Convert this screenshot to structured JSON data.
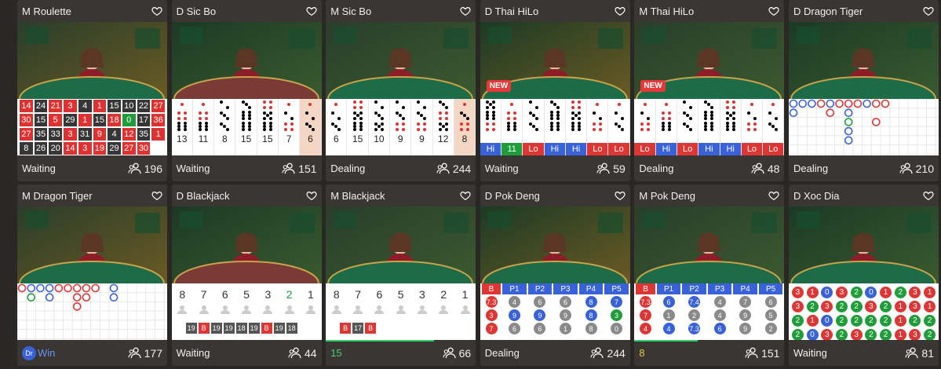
{
  "colors": {
    "accent_red": "#de3535",
    "accent_blue": "#3962d8",
    "accent_green": "#1f9d3a",
    "card_bg": "#3a3633"
  },
  "new_badge_label": "NEW",
  "cards": [
    {
      "title": "M Roulette",
      "status": "Waiting",
      "players": "196",
      "type": "roulette",
      "roulette": [
        [
          "14",
          "r"
        ],
        [
          "24",
          "k"
        ],
        [
          "21",
          "r"
        ],
        [
          "3",
          "r"
        ],
        [
          "4",
          "k"
        ],
        [
          "1",
          "r"
        ],
        [
          "15",
          "k"
        ],
        [
          "10",
          "k"
        ],
        [
          "22",
          "k"
        ],
        [
          "27",
          "r"
        ],
        [
          "30",
          "r"
        ],
        [
          "15",
          "k"
        ],
        [
          "5",
          "r"
        ],
        [
          "29",
          "k"
        ],
        [
          "1",
          "r"
        ],
        [
          "15",
          "k"
        ],
        [
          "18",
          "r"
        ],
        [
          "0",
          "g"
        ],
        [
          "17",
          "k"
        ],
        [
          "36",
          "r"
        ],
        [
          "27",
          "r"
        ],
        [
          "35",
          "k"
        ],
        [
          "33",
          "k"
        ],
        [
          "3",
          "r"
        ],
        [
          "31",
          "k"
        ],
        [
          "9",
          "r"
        ],
        [
          "4",
          "k"
        ],
        [
          "12",
          "r"
        ],
        [
          "35",
          "k"
        ],
        [
          "1",
          "r"
        ],
        [
          "8",
          "k"
        ],
        [
          "26",
          "k"
        ],
        [
          "20",
          "k"
        ],
        [
          "14",
          "r"
        ],
        [
          "3",
          "r"
        ],
        [
          "19",
          "r"
        ],
        [
          "29",
          "k"
        ],
        [
          "27",
          "r"
        ],
        [
          "30",
          "r"
        ]
      ]
    },
    {
      "title": "D Sic Bo",
      "status": "Waiting",
      "players": "151",
      "type": "sicbo",
      "dice": [
        {
          "faces": [
            1,
            4,
            6
          ],
          "sum": "13"
        },
        {
          "faces": [
            1,
            4,
            6
          ],
          "sum": "11"
        },
        {
          "faces": [
            2,
            3,
            3
          ],
          "sum": "8"
        },
        {
          "faces": [
            3,
            6,
            6
          ],
          "sum": "15"
        },
        {
          "faces": [
            4,
            5,
            6
          ],
          "sum": "15"
        },
        {
          "faces": [
            1,
            2,
            4
          ],
          "sum": "7"
        },
        {
          "faces": [
            1,
            2,
            3
          ],
          "sum": "6",
          "hl": true
        }
      ]
    },
    {
      "title": "M Sic Bo",
      "status": "Dealing",
      "players": "244",
      "type": "sicbo",
      "dice": [
        {
          "faces": [
            1,
            2,
            3
          ],
          "sum": "6"
        },
        {
          "faces": [
            4,
            5,
            6
          ],
          "sum": "15"
        },
        {
          "faces": [
            2,
            3,
            5
          ],
          "sum": "10"
        },
        {
          "faces": [
            2,
            3,
            4
          ],
          "sum": "9"
        },
        {
          "faces": [
            2,
            3,
            4
          ],
          "sum": "9"
        },
        {
          "faces": [
            3,
            4,
            5
          ],
          "sum": "12"
        },
        {
          "faces": [
            1,
            3,
            4
          ],
          "sum": "8",
          "hl": true
        }
      ]
    },
    {
      "title": "D Thai HiLo",
      "status": "Waiting",
      "players": "59",
      "type": "hilo",
      "new": true,
      "hilo": [
        {
          "faces": [
            5,
            6,
            4
          ],
          "tag": "Hi"
        },
        {
          "faces": [
            1,
            4,
            6
          ],
          "tag": "11"
        },
        {
          "faces": [
            2,
            3,
            3
          ],
          "tag": "Lo"
        },
        {
          "faces": [
            3,
            6,
            6
          ],
          "tag": "Hi"
        },
        {
          "faces": [
            4,
            5,
            6
          ],
          "tag": "Hi"
        },
        {
          "faces": [
            1,
            2,
            4
          ],
          "tag": "Lo"
        },
        {
          "faces": [
            1,
            2,
            3
          ],
          "tag": "Lo"
        }
      ]
    },
    {
      "title": "M Thai HiLo",
      "status": "Dealing",
      "players": "48",
      "type": "hilo",
      "new": true,
      "hilo": [
        {
          "faces": [
            1,
            2,
            4
          ],
          "tag": "Lo"
        },
        {
          "faces": [
            1,
            4,
            6
          ],
          "tag": "Hi"
        },
        {
          "faces": [
            2,
            3,
            3
          ],
          "tag": "Lo"
        },
        {
          "faces": [
            3,
            6,
            6
          ],
          "tag": "Hi"
        },
        {
          "faces": [
            4,
            5,
            6
          ],
          "tag": "Hi"
        },
        {
          "faces": [
            1,
            2,
            4
          ],
          "tag": "Lo"
        },
        {
          "faces": [
            1,
            2,
            3
          ],
          "tag": "Lo"
        }
      ]
    },
    {
      "title": "D Dragon Tiger",
      "status": "Dealing",
      "players": "210",
      "type": "dt1"
    },
    {
      "title": "M Dragon Tiger",
      "status": "Win",
      "status_badge": "Dr",
      "players": "177",
      "type": "dt2"
    },
    {
      "title": "D Blackjack",
      "status": "Waiting",
      "players": "44",
      "type": "bj",
      "seats": [
        "8",
        "7",
        "6",
        "5",
        "3",
        "2",
        "1"
      ],
      "history": [
        "19",
        "B",
        "19",
        "19",
        "18",
        "19",
        "B",
        "19",
        "18"
      ]
    },
    {
      "title": "M Blackjack",
      "status": "15",
      "players": "66",
      "type": "bj",
      "seats": [
        "8",
        "7",
        "6",
        "5",
        "3",
        "2",
        "1"
      ],
      "history": [
        "B",
        "17",
        "B"
      ],
      "progress": 0.72
    },
    {
      "title": "D Pok Deng",
      "status": "Dealing",
      "players": "244",
      "type": "pd",
      "pd_headers": [
        "B",
        "P1",
        "P2",
        "P3",
        "P4",
        "P5"
      ],
      "pd_cols": [
        [
          [
            "7.3",
            "red"
          ],
          [
            "3",
            "red"
          ],
          [
            "7",
            "red"
          ]
        ],
        [
          [
            "4",
            "gray"
          ],
          [
            "9",
            "blue"
          ],
          [
            "6",
            "gray"
          ]
        ],
        [
          [
            "6",
            "gray"
          ],
          [
            "9",
            "blue"
          ],
          [
            "6",
            "gray"
          ]
        ],
        [
          [
            "6",
            "gray"
          ],
          [
            "9",
            "gray"
          ],
          [
            "1",
            "gray"
          ]
        ],
        [
          [
            "8",
            "blue"
          ],
          [
            "8",
            "blue"
          ],
          [
            "8",
            "gray"
          ]
        ],
        [
          [
            "7",
            "blue"
          ],
          [
            "3",
            "green"
          ],
          [
            "0",
            "gray"
          ]
        ]
      ]
    },
    {
      "title": "M Pok Deng",
      "status": "8",
      "players": "151",
      "type": "pd",
      "pd_headers": [
        "B",
        "P1",
        "P2",
        "P3",
        "P4",
        "P5"
      ],
      "pd_cols": [
        [
          [
            "7.3",
            "red"
          ],
          [
            "7",
            "red"
          ],
          [
            "4",
            "red"
          ]
        ],
        [
          [
            "6",
            "blue"
          ],
          [
            "1",
            "gray"
          ],
          [
            "4",
            "blue"
          ]
        ],
        [
          [
            "7.4",
            "blue"
          ],
          [
            "2",
            "gray"
          ],
          [
            "7.3",
            "blue"
          ]
        ],
        [
          [
            "4",
            "gray"
          ],
          [
            "4",
            "gray"
          ],
          [
            "6",
            "blue"
          ]
        ],
        [
          [
            "7",
            "gray"
          ],
          [
            "9",
            "gray"
          ],
          [
            "9",
            "gray"
          ]
        ],
        [
          [
            "6",
            "gray"
          ],
          [
            "5",
            "gray"
          ],
          [
            "2",
            "gray"
          ]
        ]
      ],
      "progress": 0.42
    },
    {
      "title": "D Xoc Dia",
      "status": "Waiting",
      "players": "81",
      "type": "xd",
      "xd": [
        [
          "3",
          "red"
        ],
        [
          "1",
          "red"
        ],
        [
          "0",
          "blue"
        ],
        [
          "3",
          "red"
        ],
        [
          "2",
          "green"
        ],
        [
          "0",
          "blue"
        ],
        [
          "1",
          "red"
        ],
        [
          "2",
          "green"
        ],
        [
          "3",
          "red"
        ],
        [
          "1",
          "red"
        ],
        [
          "3",
          "red"
        ],
        [
          "2",
          "green"
        ],
        [
          "3",
          "red"
        ],
        [
          "2",
          "green"
        ],
        [
          "2",
          "green"
        ],
        [
          "3",
          "red"
        ],
        [
          "2",
          "green"
        ],
        [
          "1",
          "red"
        ],
        [
          "3",
          "red"
        ],
        [
          "1",
          "red"
        ],
        [
          "2",
          "green"
        ],
        [
          "1",
          "red"
        ],
        [
          "0",
          "blue"
        ],
        [
          "2",
          "green"
        ],
        [
          "2",
          "green"
        ],
        [
          "2",
          "green"
        ],
        [
          "2",
          "green"
        ],
        [
          "1",
          "red"
        ],
        [
          "2",
          "green"
        ],
        [
          "2",
          "green"
        ],
        [
          "2",
          "green"
        ],
        [
          "0",
          "blue"
        ],
        [
          "3",
          "red"
        ],
        [
          "2",
          "green"
        ],
        [
          "3",
          "red"
        ],
        [
          "2",
          "green"
        ],
        [
          "2",
          "green"
        ],
        [
          "1",
          "red"
        ],
        [
          "3",
          "red"
        ],
        [
          "2",
          "green"
        ]
      ]
    }
  ]
}
